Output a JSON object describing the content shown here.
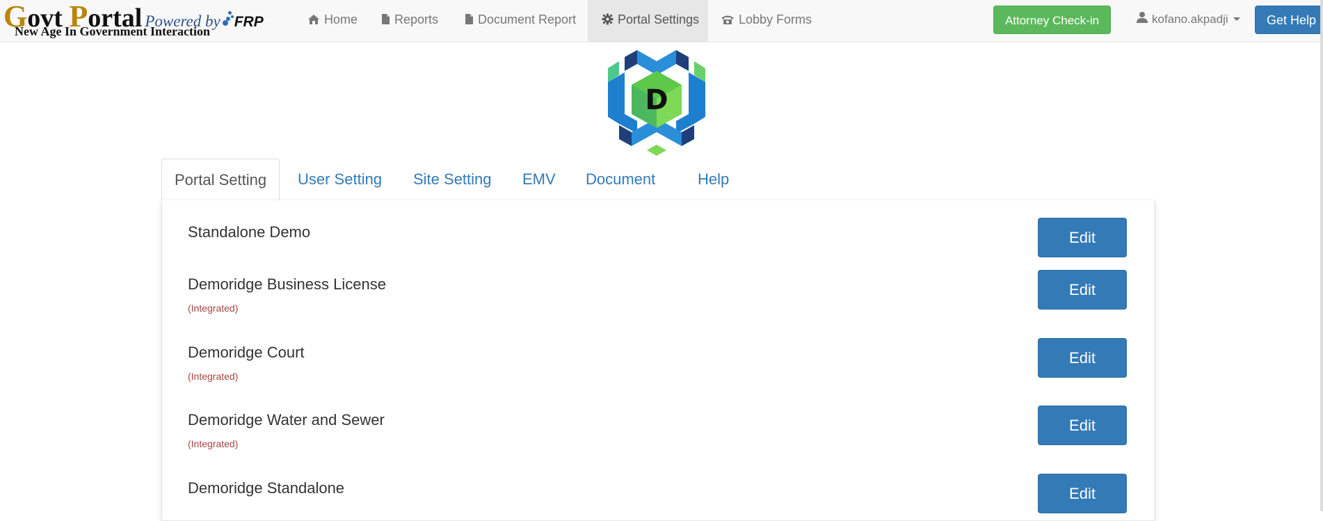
{
  "brand": {
    "g": "G",
    "ovt": "ovt ",
    "p": "P",
    "ortal": "ortal",
    "powered_by": "Powered by",
    "frp": "FRP",
    "tagline": "New Age In Government Interaction"
  },
  "nav": {
    "items": [
      {
        "label": "Home",
        "icon": "home-icon"
      },
      {
        "label": "Reports",
        "icon": "file-icon"
      },
      {
        "label": "Document Report",
        "icon": "file-icon"
      },
      {
        "label": "Portal Settings",
        "icon": "gear-icon",
        "active": true
      },
      {
        "label": "Lobby Forms",
        "icon": "phone-icon"
      }
    ],
    "attorney_checkin": "Attorney Check-in",
    "username": "kofano.akpadji",
    "get_help": "Get Help"
  },
  "logo": {
    "letter": "D"
  },
  "tabs": [
    "Portal Setting",
    "User Setting",
    "Site Setting",
    "EMV",
    "Document",
    "Help"
  ],
  "portals": [
    {
      "name": "Standalone Demo",
      "status": "",
      "edit": "Edit"
    },
    {
      "name": "Demoridge Business License",
      "status": "(Integrated)",
      "edit": "Edit"
    },
    {
      "name": "Demoridge Court",
      "status": "(Integrated)",
      "edit": "Edit"
    },
    {
      "name": "Demoridge Water and Sewer",
      "status": "(Integrated)",
      "edit": "Edit"
    },
    {
      "name": "Demoridge Standalone",
      "status": "",
      "edit": "Edit"
    }
  ],
  "colors": {
    "success": "#5cb85c",
    "primary": "#337ab7",
    "danger_text": "#a94442",
    "brand_gold": "#b8860b"
  }
}
